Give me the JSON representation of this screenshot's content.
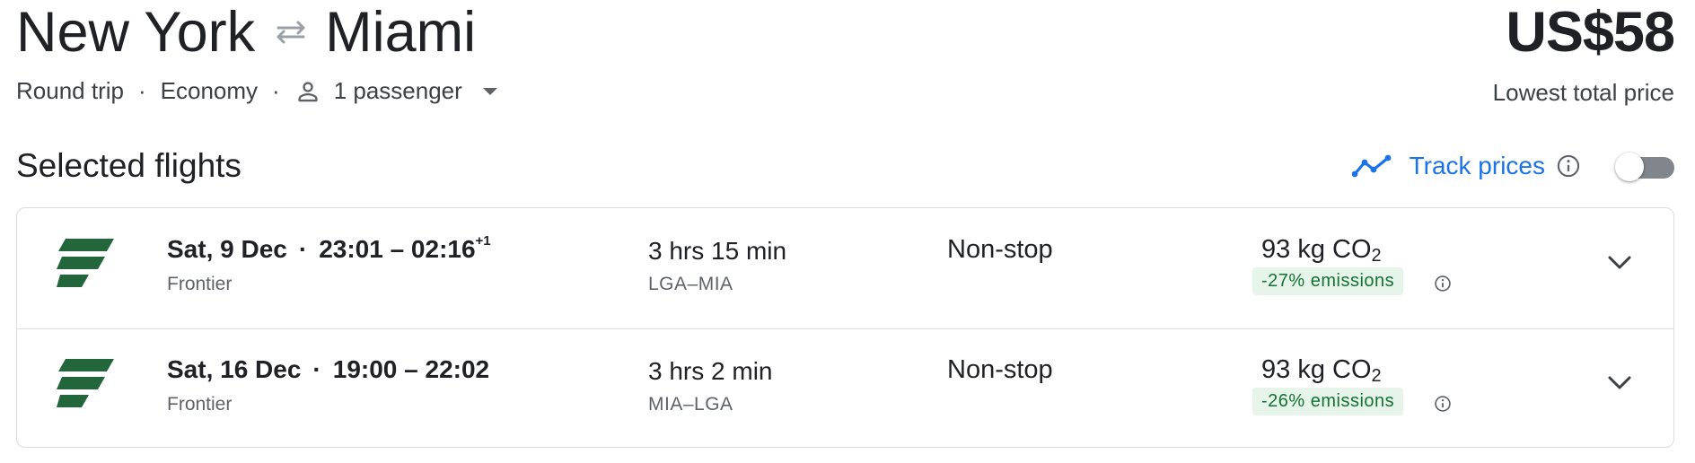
{
  "header": {
    "origin": "New York",
    "destination": "Miami",
    "swap_icon": "swap-arrows-icon",
    "price": "US$58",
    "price_label": "Lowest total price",
    "trip_type": "Round trip",
    "cabin_class": "Economy",
    "dot": "·",
    "passengers": "1 passenger",
    "passenger_icon": "person-icon"
  },
  "section": {
    "title": "Selected flights",
    "track_label": "Track prices",
    "track_icon": "trend-line-icon",
    "track_enabled": false
  },
  "flights": [
    {
      "date": "Sat, 9 Dec",
      "dot": "·",
      "times": "23:01 – 02:16",
      "day_offset": "+1",
      "airline": "Frontier",
      "duration": "3 hrs 15 min",
      "route": "LGA–MIA",
      "stops": "Non-stop",
      "co2_value": "93 kg CO",
      "co2_sub": "2",
      "emissions": "-27% emissions"
    },
    {
      "date": "Sat, 16 Dec",
      "dot": "·",
      "times": "19:00 – 22:02",
      "day_offset": "",
      "airline": "Frontier",
      "duration": "3 hrs 2 min",
      "route": "MIA–LGA",
      "stops": "Non-stop",
      "co2_value": "93 kg CO",
      "co2_sub": "2",
      "emissions": "-26% emissions"
    }
  ],
  "colors": {
    "accent": "#1a73e8",
    "airline_brand": "#24663b",
    "emissions_bg": "#e6f4ea",
    "emissions_text": "#137333"
  }
}
